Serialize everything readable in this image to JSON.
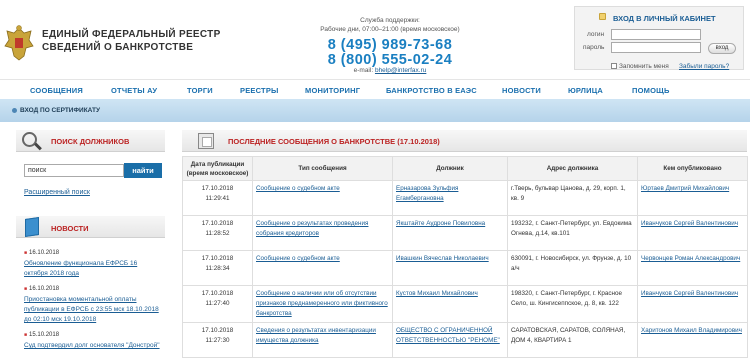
{
  "header": {
    "title_line1": "ЕДИНЫЙ ФЕДЕРАЛЬНЫЙ РЕЕСТР",
    "title_line2": "СВЕДЕНИЙ О БАНКРОТСТВЕ",
    "support_label": "Служба поддержки:",
    "support_hours": "Рабочие дни, 07:00–21:00 (время московское)",
    "phone1": "8 (495) 989-73-68",
    "phone2": "8 (800) 555-02-24",
    "email_label": "e-mail:",
    "email": "bhelp@interfax.ru"
  },
  "login": {
    "title": "ВХОД В ЛИЧНЫЙ КАБИНЕТ",
    "login_label": "логин",
    "password_label": "пароль",
    "submit": "вход",
    "remember": "Запомнить меня",
    "forgot": "Забыли пароль?"
  },
  "nav": {
    "items": [
      "СООБЩЕНИЯ",
      "ОТЧЕТЫ АУ",
      "ТОРГИ",
      "РЕЕСТРЫ",
      "МОНИТОРИНГ",
      "БАНКРОТСТВО В ЕАЭС",
      "НОВОСТИ",
      "ЮРЛИЦА",
      "ПОМОЩЬ"
    ]
  },
  "certificate": "ВХОД ПО СЕРТИФИКАТУ",
  "search": {
    "title": "ПОИСК ДОЛЖНИКОВ",
    "input_value": "поиск",
    "button": "найти",
    "advanced": "Расширенный поиск"
  },
  "news": {
    "title": "НОВОСТИ",
    "items": [
      {
        "date": "16.10.2018",
        "text": "Обновление функционала ЕФРСБ 16 октября 2018 года"
      },
      {
        "date": "16.10.2018",
        "text": "Приостановка моментальной оплаты публикации в ЕФРСБ с 23:55 мск 18.10.2018 до 02:10 мск 19.10.2018"
      },
      {
        "date": "15.10.2018",
        "text": "Суд подтвердил долг основателя \"Донстрой\""
      }
    ]
  },
  "messages": {
    "title": "ПОСЛЕДНИЕ СООБЩЕНИЯ О БАНКРОТСТВЕ (17.10.2018)",
    "columns": [
      "Дата публикации (время московское)",
      "Тип сообщения",
      "Должник",
      "Адрес должника",
      "Кем опубликовано"
    ],
    "rows": [
      {
        "date": "17.10.2018",
        "time": "11:29:41",
        "type": "Сообщение о судебном акте",
        "debtor": "Ерназарова Зульфия Егамбергановна",
        "address": "г.Тверь, бульвар Цанова, д. 29, корп. 1, кв. 9",
        "publisher": "Юртаев Дмитрий Михайлович"
      },
      {
        "date": "17.10.2018",
        "time": "11:28:52",
        "type": "Сообщение о результатах проведения собрания кредиторов",
        "debtor": "Якштайте Аудроне Повиловна",
        "address": "193232, г. Санкт-Петербург, ул. Евдокима Огнева, д.14, кв.101",
        "publisher": "Иванчуков Сергей Валентинович"
      },
      {
        "date": "17.10.2018",
        "time": "11:28:34",
        "type": "Сообщение о судебном акте",
        "debtor": "Ивашкин Вячеслав Николаевич",
        "address": "630091, г. Новосибирск, ул. Фрунзе, д. 10 а/ч",
        "publisher": "Червонцев Роман Александрович"
      },
      {
        "date": "17.10.2018",
        "time": "11:27:40",
        "type": "Сообщение о наличии или об отсутствии признаков преднамеренного или фиктивного банкротства",
        "debtor": "Кустов Михаил Михайлович",
        "address": "198320, г. Санкт-Петербург, г. Красное Село, ш. Кингисеппское, д. 8, кв. 122",
        "publisher": "Иванчуков Сергей Валентинович"
      },
      {
        "date": "17.10.2018",
        "time": "11:27:30",
        "type": "Сведения о результатах инвентаризации имущества должника",
        "debtor": "ОБЩЕСТВО С ОГРАНИЧЕННОЙ ОТВЕТСТВЕННОСТЬЮ \"РЕНОМЕ\"",
        "address": "САРАТОВСКАЯ, САРАТОВ, СОЛЯНАЯ, ДОМ 4, КВАРТИРА 1",
        "publisher": "Харитонов Михаил Владимирович"
      }
    ]
  }
}
